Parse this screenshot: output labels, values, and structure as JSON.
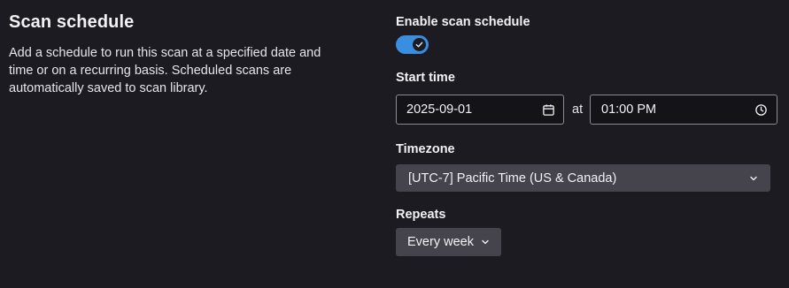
{
  "section": {
    "title": "Scan schedule",
    "description": "Add a schedule to run this scan at a specified date and time or on a recurring basis. Scheduled scans are automatically saved to scan library."
  },
  "enable": {
    "label": "Enable scan schedule",
    "checked": true
  },
  "start_time": {
    "label": "Start time",
    "date_value": "2025-09-01",
    "at_text": "at",
    "time_value": "01:00 PM"
  },
  "timezone": {
    "label": "Timezone",
    "selected": "[UTC-7] Pacific Time (US & Canada)"
  },
  "repeats": {
    "label": "Repeats",
    "selected": "Every week"
  },
  "colors": {
    "background": "#1c1b21",
    "accent": "#3a8ee0",
    "select_bg": "#45444c",
    "input_bg": "#141318"
  },
  "icons": {
    "toggle_check": "check-icon",
    "date": "calendar-icon",
    "time": "clock-icon",
    "tz_dropdown": "chevron-down-icon",
    "repeat_dropdown": "chevron-down-icon"
  }
}
